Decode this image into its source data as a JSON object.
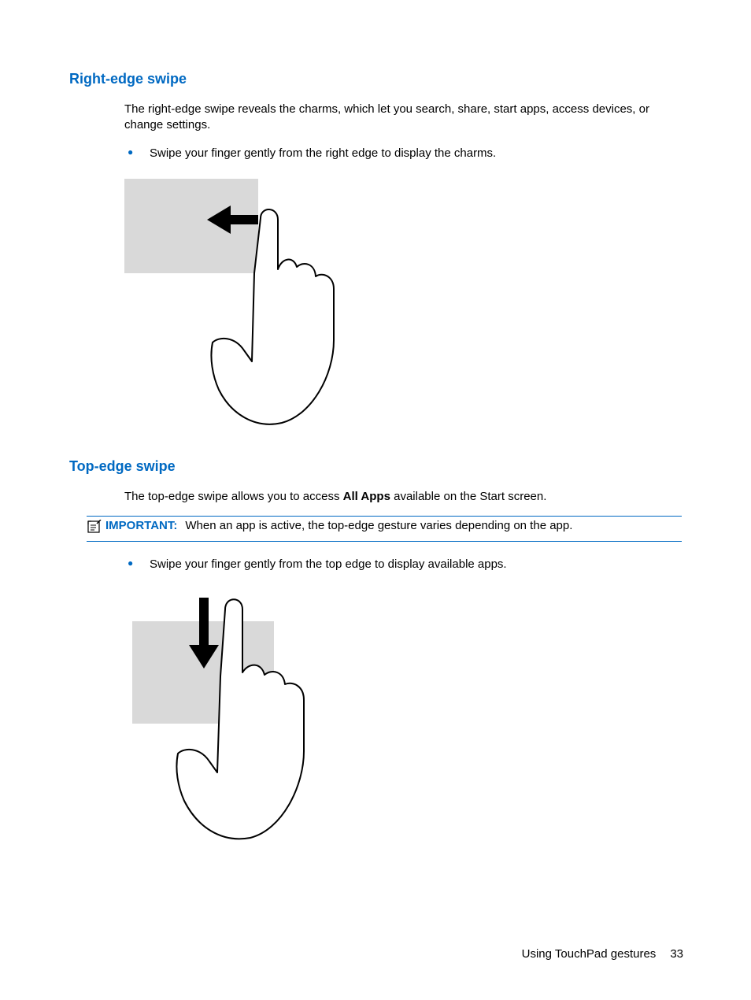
{
  "sections": {
    "right_edge": {
      "heading": "Right-edge swipe",
      "intro": "The right-edge swipe reveals the charms, which let you search, share, start apps, access devices, or change settings.",
      "bullet": "Swipe your finger gently from the right edge to display the charms."
    },
    "top_edge": {
      "heading": "Top-edge swipe",
      "intro_prefix": "The top-edge swipe allows you to access ",
      "intro_bold": "All Apps",
      "intro_suffix": " available on the Start screen.",
      "important_label": "IMPORTANT:",
      "important_text": "When an app is active, the top-edge gesture varies depending on the app.",
      "bullet": "Swipe your finger gently from the top edge to display available apps."
    }
  },
  "footer": {
    "section_title": "Using TouchPad gestures",
    "page_number": "33"
  }
}
